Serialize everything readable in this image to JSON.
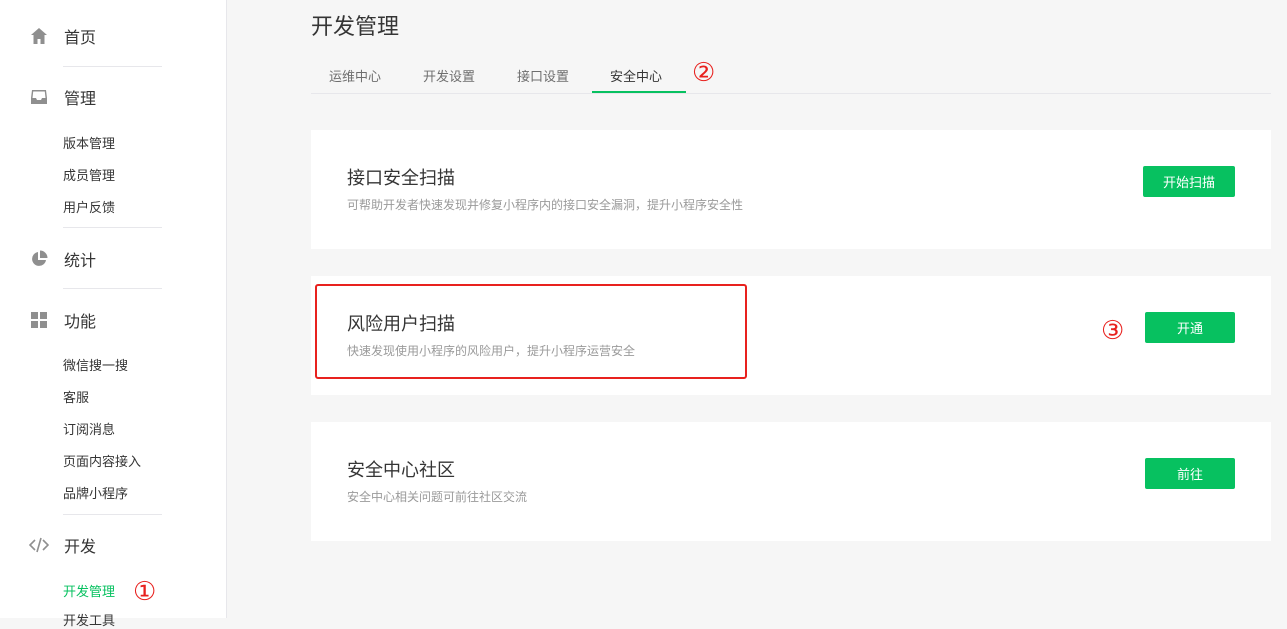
{
  "sidebar": {
    "groups": [
      {
        "label": "首页",
        "icon": "home-icon"
      },
      {
        "label": "管理",
        "icon": "inbox-icon",
        "items": [
          "版本管理",
          "成员管理",
          "用户反馈"
        ]
      },
      {
        "label": "统计",
        "icon": "pie-chart-icon"
      },
      {
        "label": "功能",
        "icon": "grid-icon",
        "items": [
          "微信搜一搜",
          "客服",
          "订阅消息",
          "页面内容接入",
          "品牌小程序"
        ]
      },
      {
        "label": "开发",
        "icon": "code-icon",
        "items": [
          "开发管理",
          "开发工具"
        ]
      }
    ],
    "active_item": "开发管理",
    "marker": "①"
  },
  "main": {
    "title": "开发管理",
    "tabs": [
      "运维中心",
      "开发设置",
      "接口设置",
      "安全中心"
    ],
    "active_tab": "安全中心",
    "tab_marker": "②",
    "cards": [
      {
        "title": "接口安全扫描",
        "desc": "可帮助开发者快速发现并修复小程序内的接口安全漏洞，提升小程序安全性",
        "button": "开始扫描"
      },
      {
        "title": "风险用户扫描",
        "desc": "快速发现使用小程序的风险用户，提升小程序运营安全",
        "button": "开通",
        "marker": "③"
      },
      {
        "title": "安全中心社区",
        "desc": "安全中心相关问题可前往社区交流",
        "button": "前往"
      }
    ]
  },
  "colors": {
    "accent": "#07c160",
    "annotation": "#e8211e",
    "background": "#f6f6f6"
  }
}
